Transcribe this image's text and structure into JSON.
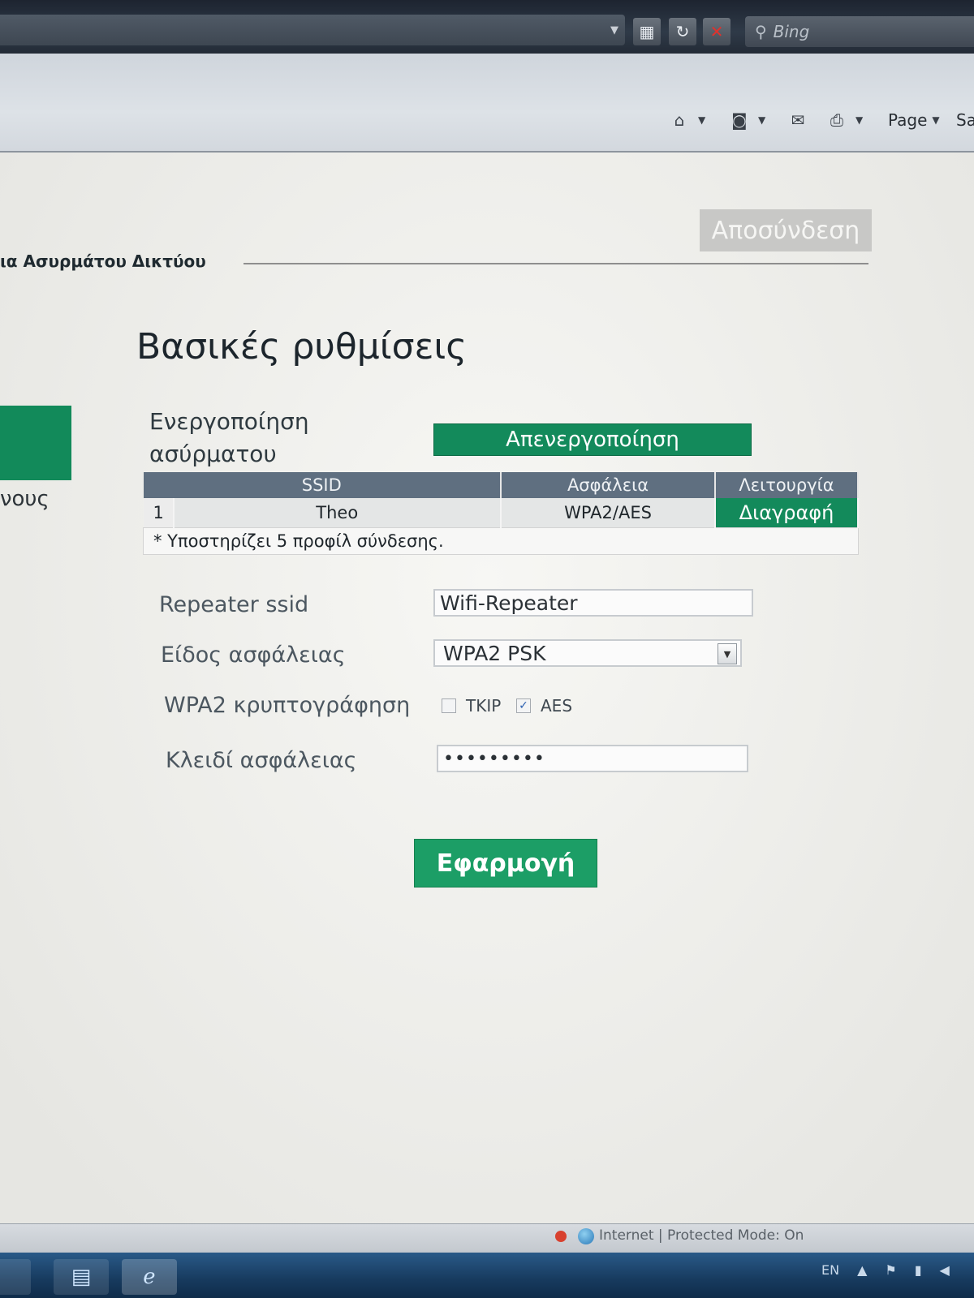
{
  "browser": {
    "search_placeholder": "Bing",
    "command_bar": {
      "page_label": "Page",
      "safety_label": "Sa"
    }
  },
  "header": {
    "logout_label": "Αποσύνδεση",
    "breadcrumb": "ια Ασυρμάτου Δικτύου"
  },
  "sidebar": {
    "partial_label": "νους"
  },
  "main": {
    "title": "Βασικές ρυθμίσεις",
    "enable_wireless_label": "Ενεργοποίηση ασύρματου",
    "disable_button_label": "Απενεργοποίηση",
    "profiles_table": {
      "headers": [
        "SSID",
        "Ασφάλεια",
        "Λειτουργία"
      ],
      "rows": [
        {
          "num": "1",
          "ssid": "Theo",
          "security": "WPA2/AES",
          "action": "Διαγραφή"
        }
      ],
      "note": "* Υποστηρίζει 5 προφίλ σύνδεσης."
    },
    "form": {
      "repeater_ssid_label": "Repeater ssid",
      "repeater_ssid_value": "Wifi-Repeater",
      "security_type_label": "Είδος ασφάλειας",
      "security_type_value": "WPA2  PSK",
      "encryption_label": "WPA2  κρυπτογράφηση",
      "tkip_label": "TKIP",
      "tkip_checked": false,
      "aes_label": "AES",
      "aes_checked": true,
      "security_key_label": "Κλειδί ασφάλειας",
      "security_key_value": "•••••••••"
    },
    "apply_button_label": "Εφαρμογή"
  },
  "statusbar": {
    "zone_text": "Internet | Protected Mode: On"
  },
  "taskbar": {
    "language": "EN"
  }
}
